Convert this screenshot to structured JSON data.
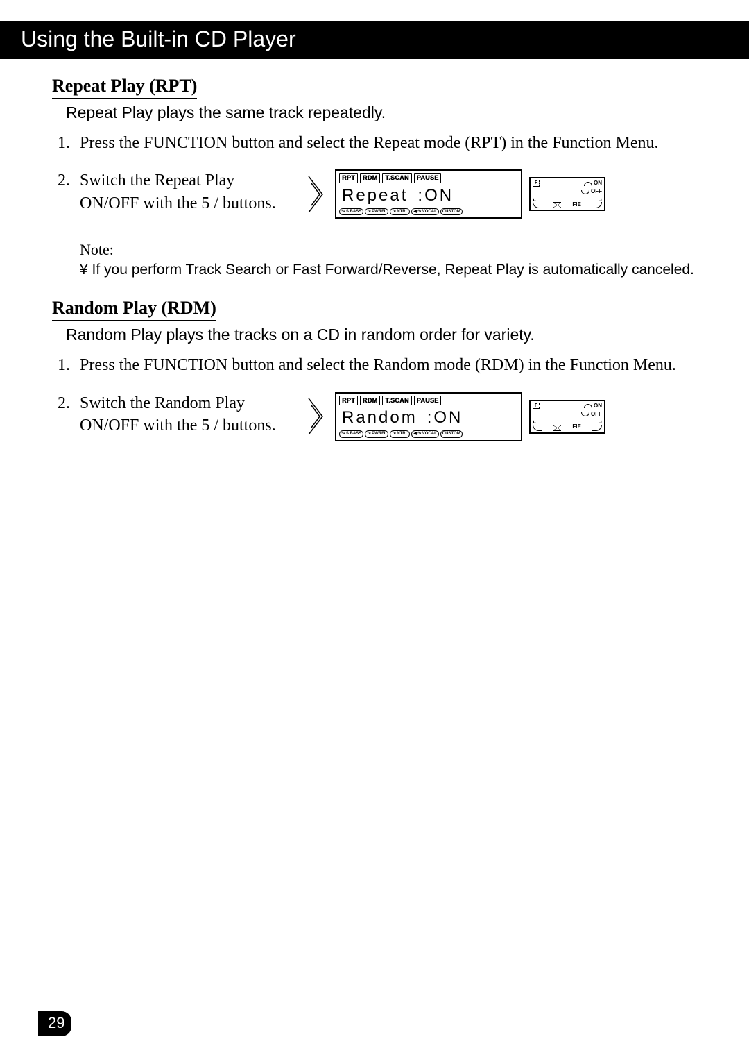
{
  "chapter_title": "Using the Built-in CD Player",
  "page_number": "29",
  "rpt": {
    "title": "Repeat Play (RPT)",
    "desc": "Repeat Play plays the same track repeatedly.",
    "step1": "Press the FUNCTION button and select the Repeat mode (RPT) in the Function Menu.",
    "step2": "Switch the Repeat Play ON/OFF with the  5 /    buttons.",
    "lcd": {
      "tabs": {
        "rpt": "RPT",
        "rdm": "RDM",
        "tscan": "T.SCAN",
        "pause": "PAUSE"
      },
      "main_label": "Repeat",
      "main_value": "ON",
      "bottom": {
        "sbass": "S.BASS",
        "pwrfl": "PWRFL",
        "ntrl": "NTRL",
        "vocal": "VOCAL",
        "custom": "CUSTOM"
      },
      "side": {
        "f_label": "F",
        "on_label": "ON",
        "off_label": "OFF",
        "fie_label": "FIE"
      }
    }
  },
  "note": {
    "label": "Note:",
    "body": "¥  If you perform Track Search or Fast Forward/Reverse, Repeat Play is automatically canceled."
  },
  "rdm": {
    "title": "Random Play (RDM)",
    "desc": "Random Play plays the tracks on a CD in random order for variety.",
    "step1": "Press the FUNCTION button and select the Random mode (RDM) in the Function Menu.",
    "step2": "Switch the Random Play ON/OFF with the  5 /    buttons.",
    "lcd": {
      "tabs": {
        "rpt": "RPT",
        "rdm": "RDM",
        "tscan": "T.SCAN",
        "pause": "PAUSE"
      },
      "main_label": "Random",
      "main_value": "ON",
      "bottom": {
        "sbass": "S.BASS",
        "pwrfl": "PWRFL",
        "ntrl": "NTRL",
        "vocal": "VOCAL",
        "custom": "CUSTOM"
      },
      "side": {
        "f_label": "F",
        "on_label": "ON",
        "off_label": "OFF",
        "fie_label": "FIE"
      }
    }
  }
}
